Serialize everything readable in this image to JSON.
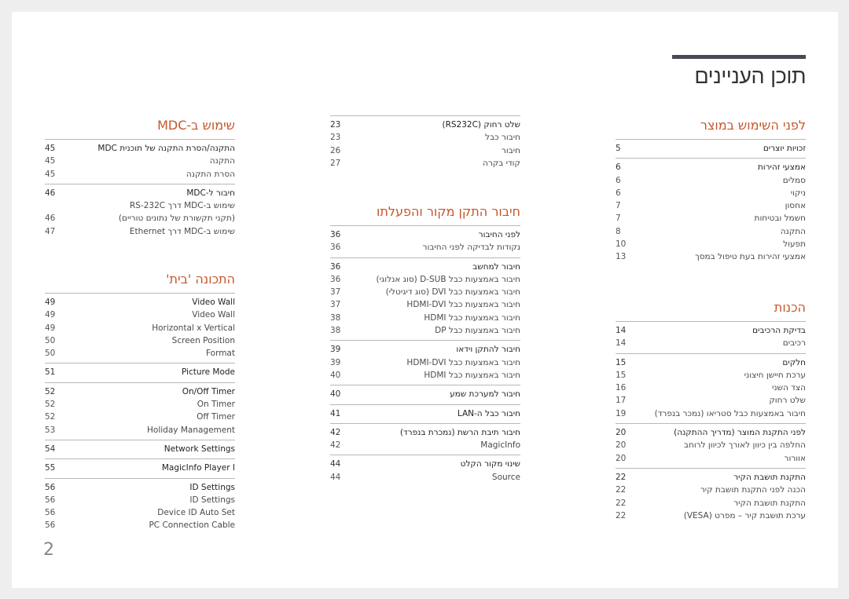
{
  "page_title": "תוכן העניינים",
  "page_number": "2",
  "colors": {
    "heading": "#c8552a",
    "topbar": "#4a4a56",
    "background": "#eeeeee"
  },
  "columns": {
    "right": [
      {
        "heading": "לפני השימוש במוצר",
        "groups": [
          {
            "items": [
              {
                "title": "זכויות יוצרים",
                "page": "5",
                "bold": true
              }
            ]
          },
          {
            "items": [
              {
                "title": "אמצעי זהירות",
                "page": "6",
                "bold": true
              },
              {
                "title": "סמלים",
                "page": "6"
              },
              {
                "title": "ניקוי",
                "page": "6"
              },
              {
                "title": "אחסון",
                "page": "7"
              },
              {
                "title": "חשמל ובטיחות",
                "page": "7"
              },
              {
                "title": "התקנה",
                "page": "8"
              },
              {
                "title": "תפעול",
                "page": "10"
              },
              {
                "title": "אמצעי זהירות בעת טיפול במסך",
                "page": "13"
              }
            ]
          }
        ]
      },
      {
        "heading": "הכנות",
        "groups": [
          {
            "items": [
              {
                "title": "בדיקת הרכיבים",
                "page": "14",
                "bold": true
              },
              {
                "title": "רכיבים",
                "page": "14"
              }
            ]
          },
          {
            "items": [
              {
                "title": "חלקים",
                "page": "15",
                "bold": true
              },
              {
                "title": "ערכת חיישן חיצוני",
                "page": "15"
              },
              {
                "title": "הצד השני",
                "page": "16"
              },
              {
                "title": "שלט רחוק",
                "page": "17"
              },
              {
                "title": "חיבור באמצעות כבל סטריאו (נמכר בנפרד)",
                "page": "19"
              }
            ]
          },
          {
            "items": [
              {
                "title": "לפני התקנת המוצר (מדריך ההתקנה)",
                "page": "20",
                "bold": true
              },
              {
                "title": "החלפה בין כיוון לאורך לכיוון לרוחב",
                "page": "20"
              },
              {
                "title": "אוורור",
                "page": "20"
              }
            ]
          },
          {
            "items": [
              {
                "title": "התקנת תושבת הקיר",
                "page": "22",
                "bold": true
              },
              {
                "title": "הכנה לפני התקנת תושבת קיר",
                "page": "22"
              },
              {
                "title": "התקנת תושבת הקיר",
                "page": "22"
              },
              {
                "title": "ערכת תושבת קיר – מפרט (VESA)",
                "page": "22"
              }
            ]
          }
        ]
      }
    ],
    "middle": [
      {
        "heading": "",
        "groups": [
          {
            "items": [
              {
                "title": "שלט רחוק (RS232C)",
                "page": "23",
                "bold": true
              },
              {
                "title": "חיבור כבל",
                "page": "23"
              },
              {
                "title": "חיבור",
                "page": "26"
              },
              {
                "title": "קודי בקרה",
                "page": "27"
              }
            ]
          }
        ]
      },
      {
        "heading": "חיבור התקן מקור והפעלתו",
        "groups": [
          {
            "items": [
              {
                "title": "לפני החיבור",
                "page": "36",
                "bold": true
              },
              {
                "title": "נקודות לבדיקה לפני החיבור",
                "page": "36"
              }
            ]
          },
          {
            "items": [
              {
                "title": "חיבור למחשב",
                "page": "36",
                "bold": true
              },
              {
                "title": "חיבור באמצעות כבל D-SUB (סוג אנלוגי)",
                "page": "36"
              },
              {
                "title": "חיבור באמצעות כבל DVI (סוג דיגיטלי)",
                "page": "37"
              },
              {
                "title": "חיבור באמצעות כבל HDMI-DVI",
                "page": "37"
              },
              {
                "title": "חיבור באמצעות כבל HDMI",
                "page": "38"
              },
              {
                "title": "חיבור באמצעות כבל DP",
                "page": "38"
              }
            ]
          },
          {
            "items": [
              {
                "title": "חיבור להתקן וידאו",
                "page": "39",
                "bold": true
              },
              {
                "title": "חיבור באמצעות כבל HDMI-DVI",
                "page": "39"
              },
              {
                "title": "חיבור באמצעות כבל HDMI",
                "page": "40"
              }
            ]
          },
          {
            "items": [
              {
                "title": "חיבור למערכת שמע",
                "page": "40",
                "bold": true
              }
            ]
          },
          {
            "items": [
              {
                "title": "חיבור כבל ה-LAN",
                "page": "41",
                "bold": true
              }
            ]
          },
          {
            "items": [
              {
                "title": "חיבור תיבת הרשת (נמכרת בנפרד)",
                "page": "42",
                "bold": true
              },
              {
                "title": "MagicInfo",
                "page": "42"
              }
            ]
          },
          {
            "items": [
              {
                "title": "שינוי מקור הקלט",
                "page": "44",
                "bold": true
              },
              {
                "title": "Source",
                "page": "44"
              }
            ]
          }
        ]
      }
    ],
    "left": [
      {
        "heading": "שימוש ב-MDC",
        "groups": [
          {
            "items": [
              {
                "title": "התקנה/הסרת התקנה של תוכנית MDC",
                "page": "45",
                "bold": true
              },
              {
                "title": "התקנה",
                "page": "45"
              },
              {
                "title": "הסרת התקנה",
                "page": "45"
              }
            ]
          },
          {
            "items": [
              {
                "title": "חיבור ל-MDC",
                "page": "46",
                "bold": true
              },
              {
                "title": "שימוש ב-MDC דרך RS-232C\n(תקני תקשורת של נתונים טוריים)",
                "page": "46"
              },
              {
                "title": "שימוש ב-MDC דרך Ethernet",
                "page": "47"
              }
            ]
          }
        ]
      },
      {
        "heading": "התכונה 'בית'",
        "groups": [
          {
            "items": [
              {
                "title": "Video Wall",
                "page": "49",
                "bold": true
              },
              {
                "title": "Video Wall",
                "page": "49"
              },
              {
                "title": "Horizontal x Vertical",
                "page": "49"
              },
              {
                "title": "Screen Position",
                "page": "50"
              },
              {
                "title": "Format",
                "page": "50"
              }
            ]
          },
          {
            "items": [
              {
                "title": "Picture Mode",
                "page": "51",
                "bold": true
              }
            ]
          },
          {
            "items": [
              {
                "title": "On/Off Timer",
                "page": "52",
                "bold": true
              },
              {
                "title": "On Timer",
                "page": "52"
              },
              {
                "title": "Off Timer",
                "page": "52"
              },
              {
                "title": "Holiday Management",
                "page": "53"
              }
            ]
          },
          {
            "items": [
              {
                "title": "Network Settings",
                "page": "54",
                "bold": true
              }
            ]
          },
          {
            "items": [
              {
                "title": "MagicInfo Player I",
                "page": "55",
                "bold": true
              }
            ]
          },
          {
            "items": [
              {
                "title": "ID Settings",
                "page": "56",
                "bold": true
              },
              {
                "title": "ID Settings",
                "page": "56"
              },
              {
                "title": "Device ID Auto Set",
                "page": "56"
              },
              {
                "title": "PC Connection Cable",
                "page": "56"
              }
            ]
          }
        ]
      }
    ]
  }
}
